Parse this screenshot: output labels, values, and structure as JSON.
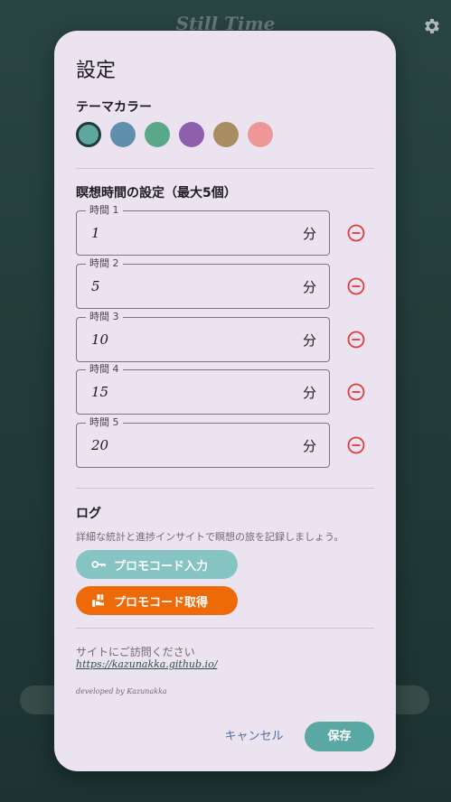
{
  "app": {
    "title": "Still Time",
    "settings_icon": "gear-icon"
  },
  "dialog": {
    "title": "設定",
    "theme": {
      "title": "テーマカラー",
      "colors": [
        "#5fa6a0",
        "#5f8fad",
        "#5aa88a",
        "#8e5fad",
        "#a98c5f",
        "#ee9698"
      ],
      "selected_index": 0
    },
    "meditation": {
      "title": "瞑想時間の設定（最大5個）",
      "unit": "分",
      "remove_icon": "minus-circle-icon",
      "times": [
        {
          "label": "時間 1",
          "value": "1"
        },
        {
          "label": "時間 2",
          "value": "5"
        },
        {
          "label": "時間 3",
          "value": "10"
        },
        {
          "label": "時間 4",
          "value": "15"
        },
        {
          "label": "時間 5",
          "value": "20"
        }
      ]
    },
    "log": {
      "title": "ログ",
      "description": "詳細な統計と進捗インサイトで瞑想の旅を記録しましょう。",
      "promo_input": {
        "label": "プロモコード入力",
        "icon": "key-icon"
      },
      "promo_get": {
        "label": "プロモコード取得",
        "icon": "gift-hand-icon"
      }
    },
    "site": {
      "label": "サイトにご訪問ください",
      "url": "https://kazunakka.github.io/"
    },
    "credit": "developed by Kazunakka",
    "actions": {
      "cancel": "キャンセル",
      "save": "保存"
    }
  },
  "colors": {
    "accent": "#5aa8a3",
    "danger": "#e23a3a",
    "promo_get": "#ee6a08",
    "promo_input": "#86c3c3"
  }
}
